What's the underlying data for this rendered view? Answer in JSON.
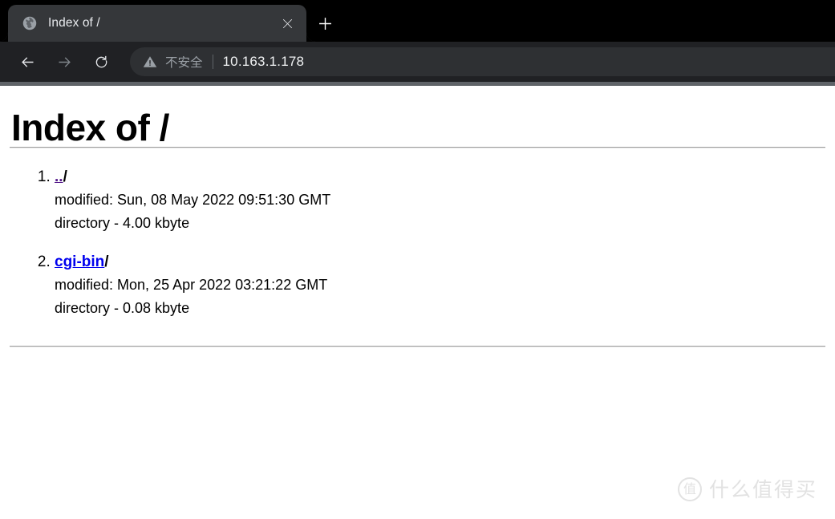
{
  "browser": {
    "tab": {
      "title": "Index of /",
      "favicon_icon": "globe-icon",
      "close_icon": "close-icon"
    },
    "new_tab_icon": "plus-icon",
    "toolbar": {
      "back_icon": "back-arrow-icon",
      "forward_icon": "forward-arrow-icon",
      "reload_icon": "reload-icon",
      "omnibox": {
        "security_icon": "warning-triangle-icon",
        "security_label": "不安全",
        "url": "10.163.1.178"
      }
    },
    "colors": {
      "tabstrip_bg": "#000000",
      "tab_bg": "#35373a",
      "toolbar_bg": "#202124",
      "omnibox_bg": "#2e3033",
      "tab_text": "#e8eaed",
      "security_text": "#9aa0a6",
      "url_text": "#f1f3f4",
      "link_visited": "#551a8b",
      "link_unvisited": "#0000ee",
      "watermark": "#e2e2e2"
    }
  },
  "page": {
    "title": "Index of /",
    "entries": [
      {
        "index": "1.",
        "name": "..",
        "name_suffix": "/",
        "link_state": "visited",
        "modified": "modified: Sun, 08 May 2022 09:51:30 GMT",
        "size": "directory - 4.00 kbyte"
      },
      {
        "index": "2.",
        "name": "cgi-bin",
        "name_suffix": "/",
        "link_state": "unvisited",
        "modified": "modified: Mon, 25 Apr 2022 03:21:22 GMT",
        "size": "directory - 0.08 kbyte"
      }
    ]
  },
  "watermark": {
    "badge": "值",
    "text": "什么值得买"
  }
}
